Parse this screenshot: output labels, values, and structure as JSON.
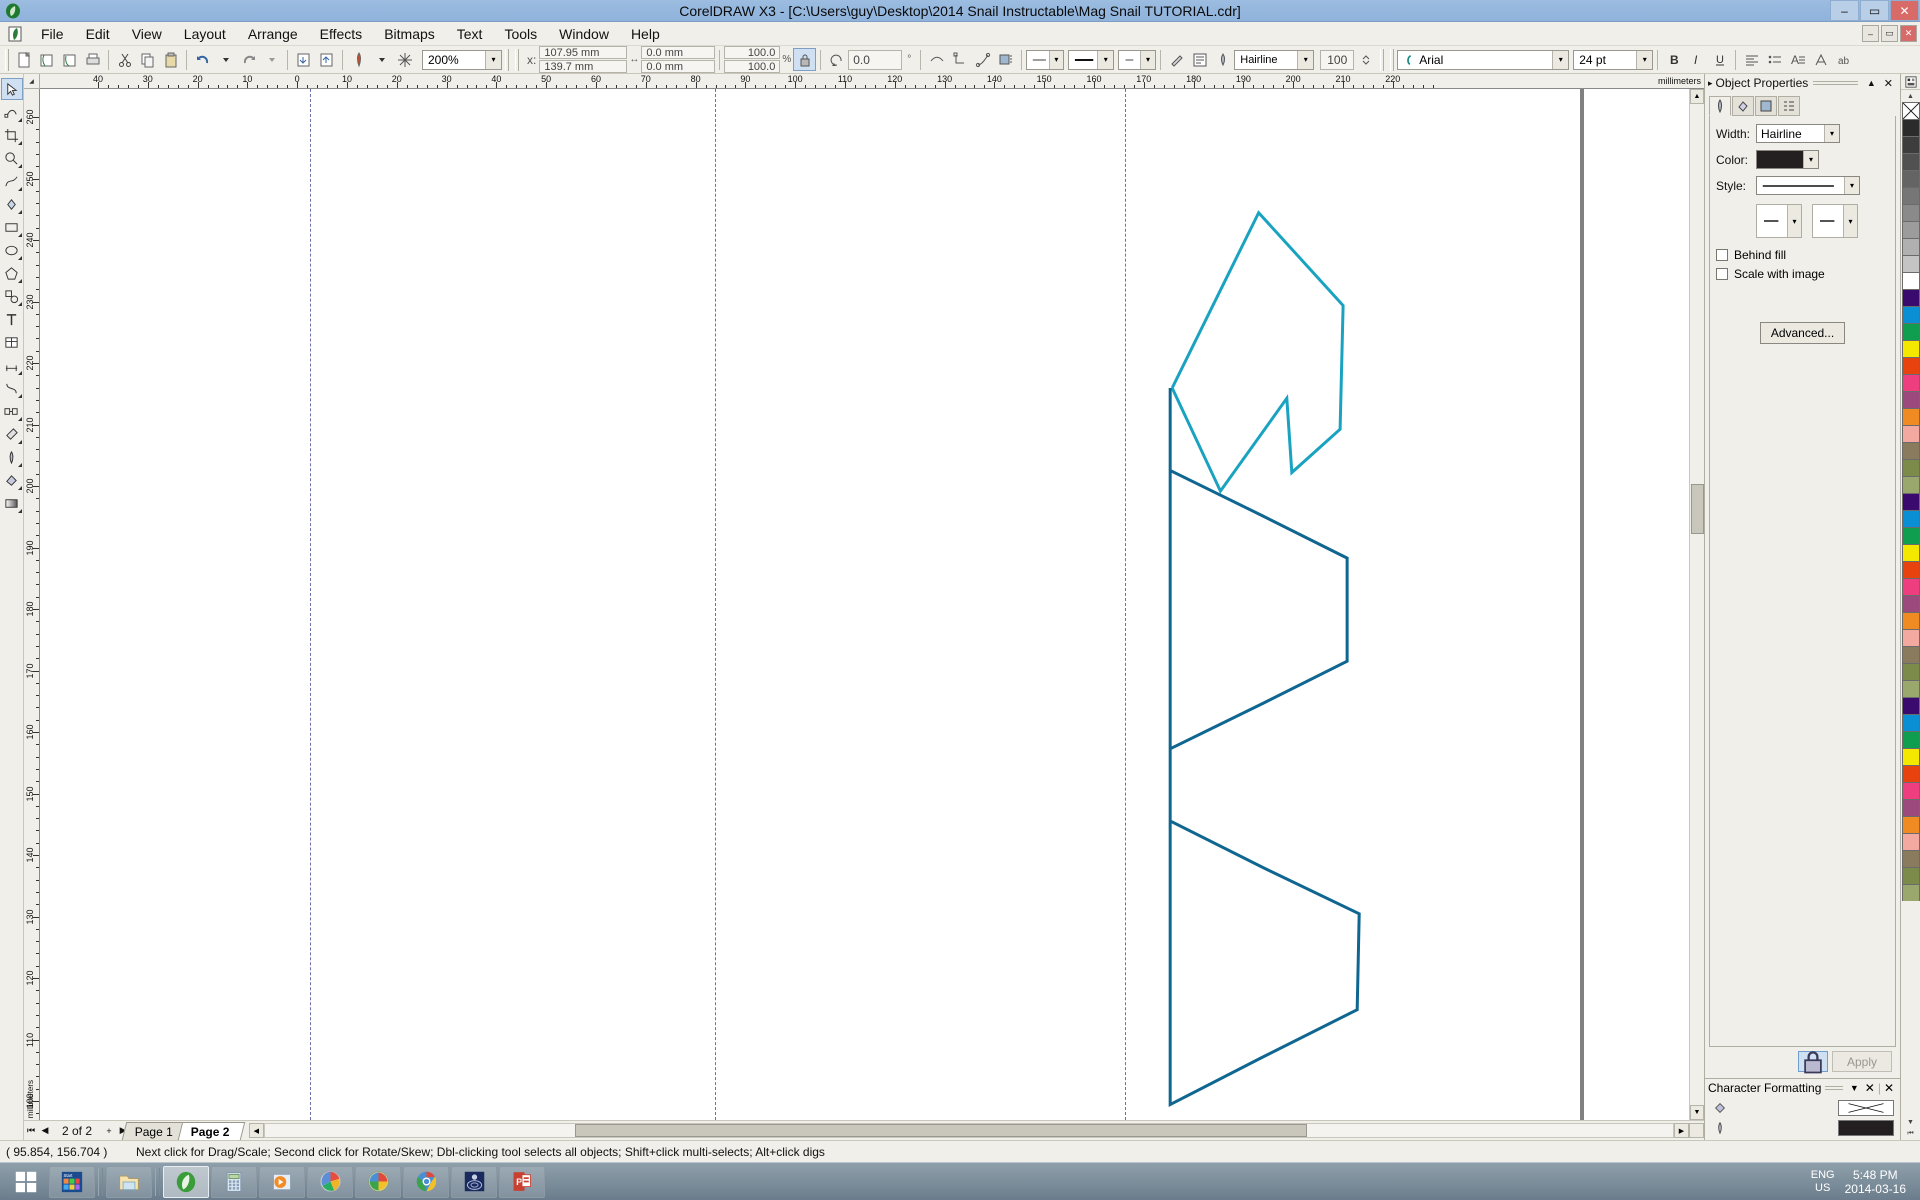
{
  "titlebar": {
    "app_title": "CorelDRAW X3 - [C:\\Users\\guy\\Desktop\\2014 Snail Instructable\\Mag Snail TUTORIAL.cdr]",
    "minimize": "–",
    "maximize": "▭",
    "close": "✕"
  },
  "menubar": {
    "items": [
      {
        "label": "File"
      },
      {
        "label": "Edit"
      },
      {
        "label": "View"
      },
      {
        "label": "Layout"
      },
      {
        "label": "Arrange"
      },
      {
        "label": "Effects"
      },
      {
        "label": "Bitmaps"
      },
      {
        "label": "Text"
      },
      {
        "label": "Tools"
      },
      {
        "label": "Window"
      },
      {
        "label": "Help"
      }
    ],
    "doc_minimize": "–",
    "doc_restore": "▭",
    "doc_close": "✕"
  },
  "propbar": {
    "zoom_level": "200%",
    "x_label": "x:",
    "x_value": "107.95 mm",
    "y_label": "y:",
    "y_value": "139.7 mm",
    "width_value": "0.0 mm",
    "height_value": "0.0 mm",
    "scale_h": "100.0",
    "scale_v": "100.0",
    "percent_sign": "%",
    "rotation_value": "0.0",
    "degree_sign": "°",
    "outline_width": "Hairline",
    "outline_unit": "100",
    "font_name": "Arial",
    "font_size": "24 pt"
  },
  "toolbox": {
    "tools": [
      {
        "name": "pick-tool"
      },
      {
        "name": "shape-tool"
      },
      {
        "name": "crop-tool"
      },
      {
        "name": "zoom-tool"
      },
      {
        "name": "freehand-tool"
      },
      {
        "name": "smart-fill-tool"
      },
      {
        "name": "rectangle-tool"
      },
      {
        "name": "ellipse-tool"
      },
      {
        "name": "polygon-tool"
      },
      {
        "name": "basic-shapes-tool"
      },
      {
        "name": "text-tool"
      },
      {
        "name": "table-tool"
      },
      {
        "name": "dimension-tool"
      },
      {
        "name": "connector-tool"
      },
      {
        "name": "blend-tool"
      },
      {
        "name": "eyedropper-tool"
      },
      {
        "name": "outline-tool"
      },
      {
        "name": "fill-tool"
      },
      {
        "name": "interactive-fill-tool"
      }
    ]
  },
  "rulers": {
    "unit_label": "millimeters",
    "h_ticks": [
      40,
      30,
      20,
      10,
      0,
      10,
      20,
      30,
      40,
      50,
      60,
      70,
      80,
      90,
      100,
      110,
      120,
      130,
      140,
      150,
      160,
      170,
      180,
      190,
      200,
      210,
      220
    ],
    "v_ticks": [
      260,
      250,
      240,
      230,
      220,
      210,
      200,
      190,
      180,
      170,
      160,
      150,
      140,
      130,
      120,
      110,
      100
    ]
  },
  "drawing": {
    "color_light": "#19a3c0",
    "color_dark": "#0f6690",
    "stroke_width": 3
  },
  "pagebar": {
    "first": "⏮",
    "prev": "◀",
    "page_count": "2 of 2",
    "add": "+",
    "next": "▶",
    "tabs": [
      {
        "label": "Page 1",
        "active": false
      },
      {
        "label": "Page 2",
        "active": true
      }
    ]
  },
  "docker": {
    "title": "Object Properties",
    "collapse": "▲",
    "close": "✕",
    "tabs": [
      {
        "name": "outline-tab",
        "active": true
      },
      {
        "name": "fill-tab",
        "active": false
      },
      {
        "name": "general-tab",
        "active": false
      },
      {
        "name": "detail-tab",
        "active": false
      }
    ],
    "width_label": "Width:",
    "width_value": "Hairline",
    "color_label": "Color:",
    "color_value": "#231f20",
    "style_label": "Style:",
    "behind_fill": "Behind fill",
    "scale_with_image": "Scale with image",
    "advanced_button": "Advanced...",
    "apply_button": "Apply",
    "lock_icon": "lock-icon"
  },
  "charbar": {
    "title": "Character Formatting",
    "collapse": "▼",
    "close_one": "✕",
    "close_two": "✕",
    "dock_arrow": "⏮"
  },
  "colorstrip_footer": {
    "fill_icon": "paint-bucket-icon",
    "fill_value": "none",
    "outline_icon": "pen-nib-icon",
    "outline_value": "#231f20"
  },
  "palette": {
    "colors": [
      "none",
      "#2b2b2b",
      "#3d3d3d",
      "#515151",
      "#646464",
      "#767676",
      "#8a8a8a",
      "#9c9c9c",
      "#b0b0b0",
      "#c4c4c4",
      "#ffffff",
      "#3b0a6e",
      "#0b8fd4",
      "#0f9d4f",
      "#f5e800",
      "#e8430f",
      "#ef3e7f",
      "#9c4a7e",
      "#f08a22",
      "#f4a9a0",
      "#8a7a5e",
      "#7c8a4a",
      "#9aa86e"
    ]
  },
  "statusbar": {
    "coordinates": "( 95.854, 156.704 )",
    "hint": "Next click for Drag/Scale; Second click for Rotate/Skew; Dbl-clicking tool selects all objects; Shift+click multi-selects; Alt+click digs"
  },
  "taskbar": {
    "start": "start-button",
    "items": [
      {
        "name": "start-menu-tile-icon"
      },
      {
        "name": "file-explorer-icon"
      },
      {
        "name": "coreldraw-icon",
        "active": true
      },
      {
        "name": "calculator-icon"
      },
      {
        "name": "media-player-icon"
      },
      {
        "name": "picasa-icon"
      },
      {
        "name": "windows-photo-viewer-icon"
      },
      {
        "name": "google-chrome-icon"
      },
      {
        "name": "cd-burner-icon"
      },
      {
        "name": "powerpoint-icon"
      }
    ],
    "language": "ENG",
    "region": "US",
    "time": "5:48 PM",
    "date": "2014-03-16"
  }
}
